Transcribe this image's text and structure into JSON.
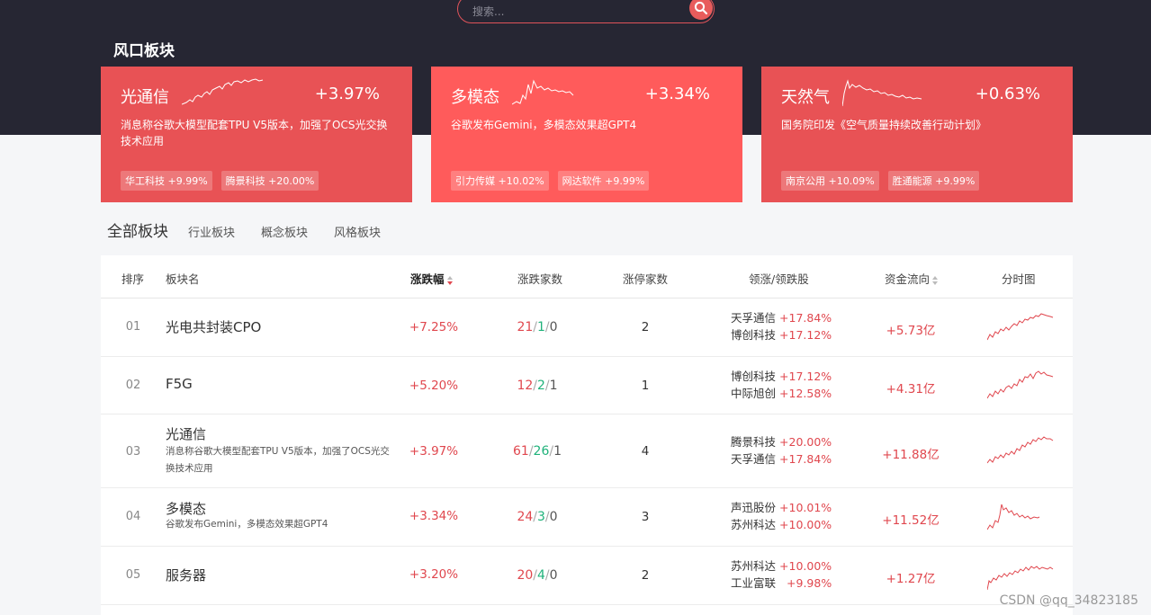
{
  "search": {
    "placeholder": "搜索..."
  },
  "section_title": "风口板块",
  "hot_cards": [
    {
      "name": "光通信",
      "pct": "+3.97%",
      "desc": "消息称谷歌大模型配套TPU V5版本，加强了OCS光交换技术应用",
      "bg": "#e85255",
      "tags": [
        "华工科技 +9.99%",
        "腾景科技 +20.00%"
      ]
    },
    {
      "name": "多模态",
      "pct": "+3.34%",
      "desc": "谷歌发布Gemini，多模态效果超GPT4",
      "bg": "#ff5b5b",
      "tags": [
        "引力传媒 +10.02%",
        "网达软件 +9.99%"
      ]
    },
    {
      "name": "天然气",
      "pct": "+0.63%",
      "desc": "国务院印发《空气质量持续改善行动计划》",
      "bg": "#e85255",
      "tags": [
        "南京公用 +10.09%",
        "胜通能源 +9.99%"
      ]
    }
  ],
  "tabs": {
    "main": "全部板块",
    "items": [
      "行业板块",
      "概念板块",
      "风格板块"
    ]
  },
  "table": {
    "headers": {
      "rank": "排序",
      "name": "板块名",
      "change": "涨跌幅",
      "counts": "涨跌家数",
      "limit_up": "涨停家数",
      "leaders": "领涨/领跌股",
      "flow": "资金流向",
      "intraday": "分时图"
    },
    "rows": [
      {
        "rank": "01",
        "name": "光电共封装CPO",
        "desc": "",
        "change": "+7.25%",
        "up": "21",
        "flat": "1",
        "down": "0",
        "limit_up": "2",
        "leader1": "天孚通信",
        "leader1_pct": "+17.84%",
        "leader2": "博创科技",
        "leader2_pct": "+17.12%",
        "flow": "+5.73亿"
      },
      {
        "rank": "02",
        "name": "F5G",
        "desc": "",
        "change": "+5.20%",
        "up": "12",
        "flat": "2",
        "down": "1",
        "limit_up": "1",
        "leader1": "博创科技",
        "leader1_pct": "+17.12%",
        "leader2": "中际旭创",
        "leader2_pct": "+12.58%",
        "flow": "+4.31亿"
      },
      {
        "rank": "03",
        "name": "光通信",
        "desc": "消息称谷歌大模型配套TPU V5版本，加强了OCS光交换技术应用",
        "change": "+3.97%",
        "up": "61",
        "flat": "26",
        "down": "1",
        "limit_up": "4",
        "leader1": "腾景科技",
        "leader1_pct": "+20.00%",
        "leader2": "天孚通信",
        "leader2_pct": "+17.84%",
        "flow": "+11.88亿"
      },
      {
        "rank": "04",
        "name": "多模态",
        "desc": "谷歌发布Gemini，多模态效果超GPT4",
        "change": "+3.34%",
        "up": "24",
        "flat": "3",
        "down": "0",
        "limit_up": "3",
        "leader1": "声迅股份",
        "leader1_pct": "+10.01%",
        "leader2": "苏州科达",
        "leader2_pct": "+10.00%",
        "flow": "+11.52亿"
      },
      {
        "rank": "05",
        "name": "服务器",
        "desc": "",
        "change": "+3.20%",
        "up": "20",
        "flat": "4",
        "down": "0",
        "limit_up": "2",
        "leader1": "苏州科达",
        "leader1_pct": "+10.00%",
        "leader2": "工业富联",
        "leader2_pct": "+9.98%",
        "flow": "+1.27亿"
      }
    ]
  },
  "watermark": "CSDN @qq_34823185",
  "colors": {
    "accent": "#e85255",
    "up": "#e0474e",
    "down": "#1fb27a",
    "header_bg": "#262633"
  }
}
